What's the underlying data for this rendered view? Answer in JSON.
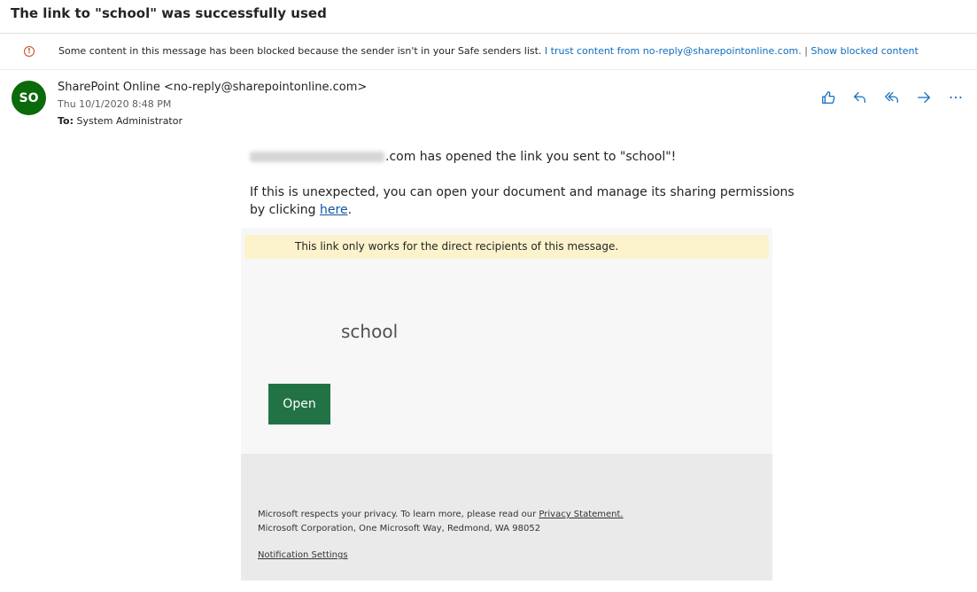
{
  "subject": "The link to \"school\" was successfully used",
  "info_bar": {
    "icon": "info-icon",
    "message": "Some content in this message has been blocked because the sender isn't in your Safe senders list.",
    "trust_link": "I trust content from no-reply@sharepointonline.com.",
    "separator": "|",
    "show_blocked_link": "Show blocked content"
  },
  "header": {
    "avatar_initials": "SO",
    "avatar_color": "#0b6a0b",
    "sender": "SharePoint Online <no-reply@sharepointonline.com>",
    "date": "Thu 10/1/2020 8:48 PM",
    "to_label": "To:",
    "to_value": "System Administrator",
    "actions": [
      "like-icon",
      "reply-icon",
      "reply-all-icon",
      "forward-icon",
      "more-actions-icon"
    ]
  },
  "body": {
    "opened_suffix": ".com has opened the link you sent to \"school\"!",
    "unexpected_line1": "If this is unexpected, you can open your document and manage its sharing permissions",
    "unexpected_line2_prefix": "by clicking ",
    "here_link": "here",
    "unexpected_line2_suffix": "."
  },
  "card": {
    "banner": "This link only works for the direct recipients of this message.",
    "banner_color": "#fcf3cd",
    "doc_name": "school",
    "open_button": "Open",
    "open_button_color": "#217346",
    "privacy_prefix": "Microsoft respects your privacy. To learn more, please read our ",
    "privacy_link": "Privacy Statement.",
    "address": "Microsoft Corporation, One Microsoft Way, Redmond, WA 98052",
    "notification_settings": "Notification Settings"
  },
  "colors": {
    "link": "#0f6cbd",
    "accent": "#0f6cbd"
  }
}
